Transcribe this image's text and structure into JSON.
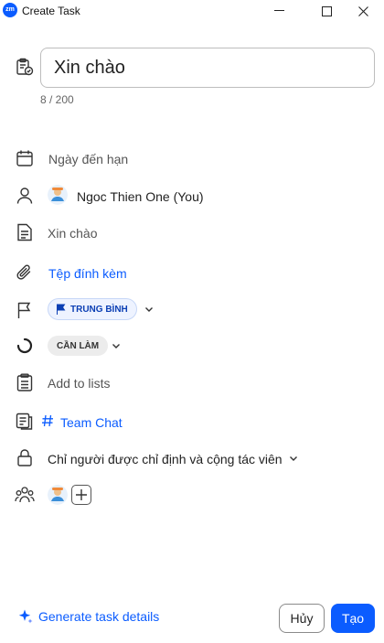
{
  "window": {
    "title": "Create Task",
    "logo_text": "zm"
  },
  "task": {
    "title_value": "Xin chào",
    "char_count": "8 / 200"
  },
  "fields": {
    "due_date": "Ngày đến hạn",
    "assignee": "Ngoc Thien One (You)",
    "description": "Xin chào",
    "attachment": "Tệp đính kèm",
    "priority": "TRUNG BÌNH",
    "status": "CẦN LÀM",
    "lists": "Add to lists",
    "channel": "Team Chat",
    "visibility": "Chỉ người được chỉ định và cộng tác viên"
  },
  "footer": {
    "generate": "Generate task details",
    "cancel": "Hủy",
    "create": "Tạo"
  },
  "colors": {
    "accent": "#0b5cff",
    "priority_bg": "#eef3ff",
    "status_bg": "#ececec"
  }
}
